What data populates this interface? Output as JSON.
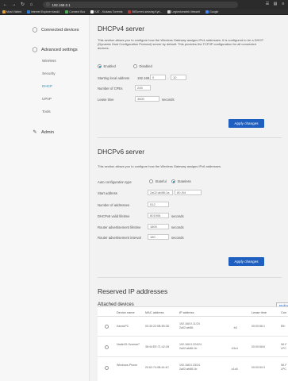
{
  "browser": {
    "url": "192.168.0.1",
    "bookmarks": [
      {
        "label": "Most Visited",
        "color": "#e6a23c"
      },
      {
        "label": "Internet Explorer kezdő",
        "color": "#2a7fd4"
      },
      {
        "label": "Connect Box",
        "color": "#4caf50"
      },
      {
        "label": "KAT - Kickass Torrents",
        "color": "#f2f2f2"
      },
      {
        "label": "BitTorrent-sessing Kyri...",
        "color": "#b63a3a"
      },
      {
        "label": "Legkedvesebb lítészeti",
        "color": "#d0d0d0"
      },
      {
        "label": "Google",
        "color": "#4285f4"
      }
    ]
  },
  "sidebar": {
    "connected_devices": "Connected devices",
    "advanced_settings": "Advanced settings",
    "items": [
      "Wireless",
      "Security",
      "DHCP",
      "UPnP",
      "Tools"
    ],
    "active_item": "DHCP",
    "admin": "Admin"
  },
  "dhcpv4": {
    "title": "DHCPv4 server",
    "description": "This section allows you to configure how the Wireless Gateway assigns IPv4 addresses. It is configured to be a DHCP (Dynamic Host Configuration Protocol) server by default. This provides the TCP/IP configuration for all connected devices.",
    "enabled_label": "Enabled",
    "disabled_label": "Disabled",
    "enabled": true,
    "starting_address_label": "Starting local address",
    "starting_prefix": "192.168.",
    "starting_octet3": "0",
    "starting_octet4": "10",
    "num_cpes_label": "Number of CPEs",
    "num_cpes": "245",
    "lease_time_label": "Lease time",
    "lease_time": "3600",
    "lease_unit": "seconds",
    "apply_label": "Apply changes"
  },
  "dhcpv6": {
    "title": "DHCPv6 server",
    "description": "This section allows you to configure how the Wireless Gateway assigns IPv6 addresses.",
    "auto_config_label": "Auto configuration type",
    "stateful_label": "Stateful",
    "stateless_label": "Stateless",
    "selected": "Stateless",
    "start_address_label": "Start address",
    "start_address": "2a02:ab88:1a",
    "start_address_suffix": "80 /64",
    "num_addresses_label": "Number of addresses",
    "num_addresses": "512",
    "valid_lifetime_label": "DHCPv6 valid lifetime",
    "valid_lifetime": "801906",
    "router_adv_lifetime_label": "Router advertisement lifetime",
    "router_adv_lifetime": "1800",
    "router_adv_interval_label": "Router advertisement interval",
    "router_adv_interval": "180",
    "unit": "seconds",
    "apply_label": "Apply changes"
  },
  "reserved": {
    "title": "Reserved IP addresses",
    "attached_title": "Attached devices",
    "refresh_label": "Refre",
    "columns": [
      "Device name",
      "MAC address",
      "IP address",
      "Lease time",
      "Con"
    ],
    "rows": [
      {
        "name": "KandoPC",
        "mac": "00:30:22:0B:3B:3D",
        "ip1": "192.168.0.11/24",
        "ip2": "2a02:ab88:",
        "ip2_suffix": ":b3",
        "lease": "00:00:56:1",
        "conn": "Eth"
      },
      {
        "name": "Nadin25-Szamar7",
        "mac": "38:44:EE:71:42:1B",
        "ip1": "192.168.0.224/24",
        "ip2": "2a02:ab88:1b:",
        "ip2_suffix": ":43c4",
        "lease": "00:00:58:6",
        "conn": "Wi-F\nLPC"
      },
      {
        "name": "Windows-Phone",
        "mac": "20:62:74:0B:44:4C",
        "ip1": "192.168.0.33/24",
        "ip2": "2a02:ab88:1b:",
        "ip2_suffix": ":c1c6",
        "lease": "00:00:50:3",
        "conn": "Wi-F\nLPC"
      }
    ]
  },
  "colors": {
    "accent": "#2196b6",
    "button": "#1f5fc0"
  }
}
